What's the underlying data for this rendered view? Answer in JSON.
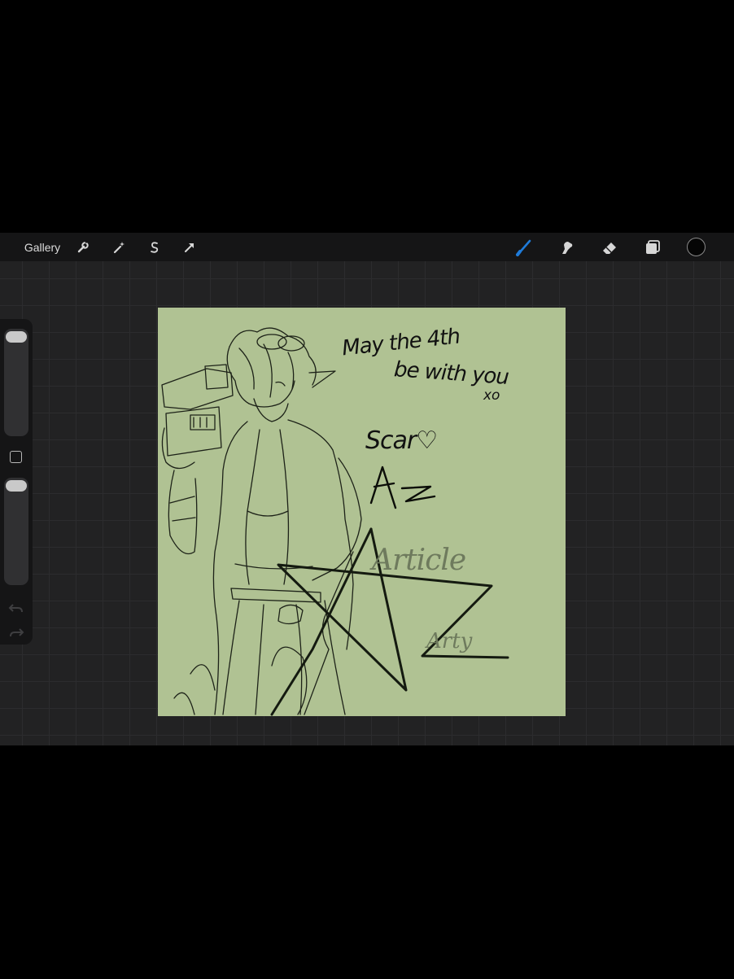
{
  "toolbar": {
    "gallery_label": "Gallery",
    "left_tools": [
      {
        "name": "actions",
        "icon": "wrench-icon"
      },
      {
        "name": "adjustments",
        "icon": "magic-wand-icon"
      },
      {
        "name": "selection",
        "icon": "selection-s-icon"
      },
      {
        "name": "transform",
        "icon": "arrow-cursor-icon"
      }
    ],
    "right_tools": [
      {
        "name": "brush",
        "icon": "brush-icon",
        "active": true
      },
      {
        "name": "smudge",
        "icon": "smudge-finger-icon"
      },
      {
        "name": "eraser",
        "icon": "eraser-icon"
      },
      {
        "name": "layers",
        "icon": "layers-icon"
      }
    ],
    "current_color": "#050505",
    "active_color": "#1f7bd9"
  },
  "sidebar": {
    "brush_size_slider": "slider",
    "opacity_slider": "slider",
    "undo_icon": "undo-arrow-icon",
    "redo_icon": "redo-arrow-icon"
  },
  "canvas": {
    "background_color": "#b0c293",
    "note_line1": "May the 4th",
    "note_line2": "be with you",
    "note_xo": "xo",
    "name": "Scar♡",
    "watermark_line1": "Article",
    "watermark_line2": "Arty"
  }
}
